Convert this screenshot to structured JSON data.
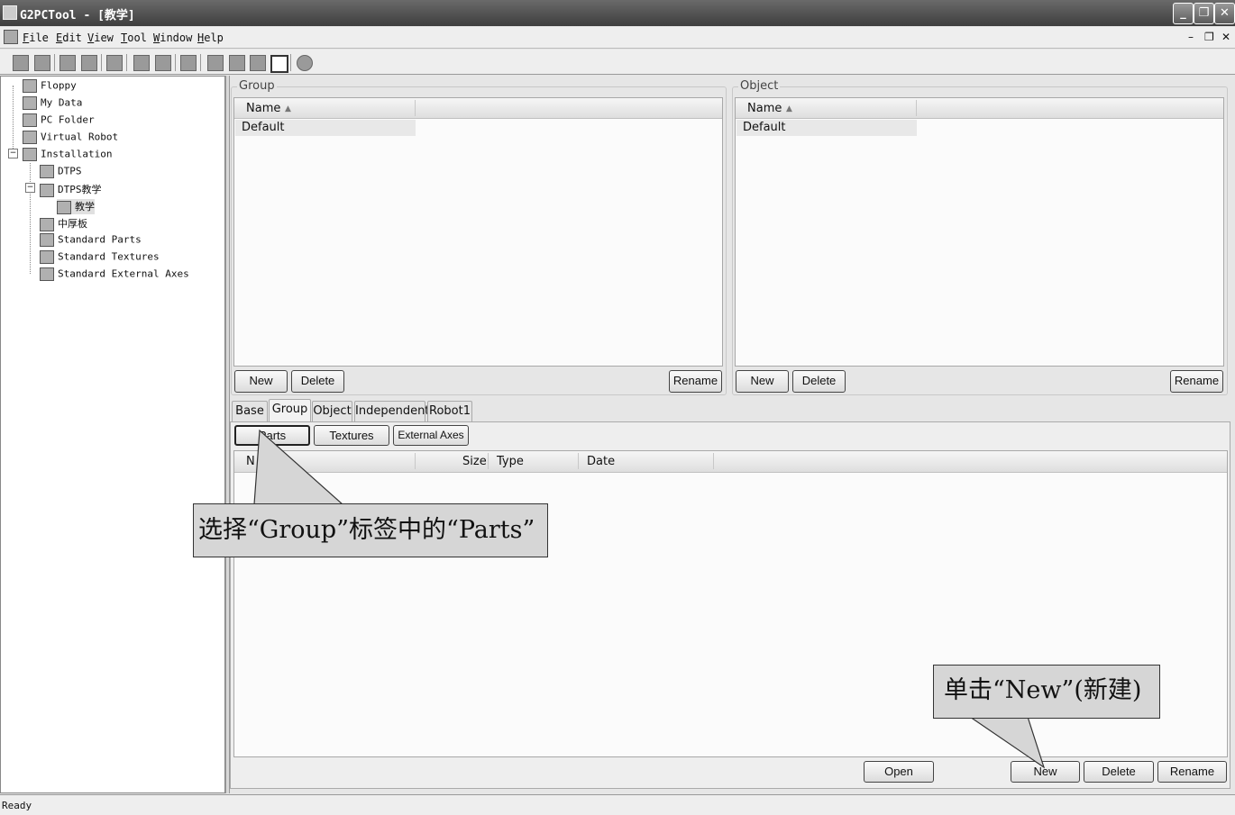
{
  "window": {
    "title": "G2PCTool - [教学]"
  },
  "menu": {
    "items": [
      "File",
      "Edit",
      "View",
      "Tool",
      "Window",
      "Help"
    ]
  },
  "tree": {
    "nodes": [
      "Floppy",
      "My Data",
      "PC Folder",
      "Virtual Robot",
      "Installation",
      "DTPS",
      "DTPS教学",
      "教学",
      "中厚板",
      "Standard Parts",
      "Standard Textures",
      "Standard External Axes"
    ]
  },
  "group_panel": {
    "legend": "Group",
    "column": "Name",
    "sort_arrow": "▲",
    "rows": [
      "Default"
    ],
    "new_label": "New",
    "delete_label": "Delete",
    "rename_label": "Rename"
  },
  "object_panel": {
    "legend": "Object",
    "column": "Name",
    "sort_arrow": "▲",
    "rows": [
      "Default"
    ],
    "new_label": "New",
    "delete_label": "Delete",
    "rename_label": "Rename"
  },
  "tabs": [
    "Base",
    "Group",
    "Object",
    "Independent",
    "Robot1"
  ],
  "active_tab": "Group",
  "subtabs": [
    "Parts",
    "Textures",
    "External Axes"
  ],
  "file_table": {
    "columns": [
      "N",
      "Size",
      "Type",
      "Date"
    ]
  },
  "bottom_buttons": {
    "open": "Open",
    "new": "New",
    "delete": "Delete",
    "rename": "Rename"
  },
  "callouts": {
    "select_parts": "选择“Group”标签中的“Parts”",
    "click_new": "单击“New”(新建)"
  },
  "status": {
    "text": "Ready"
  }
}
